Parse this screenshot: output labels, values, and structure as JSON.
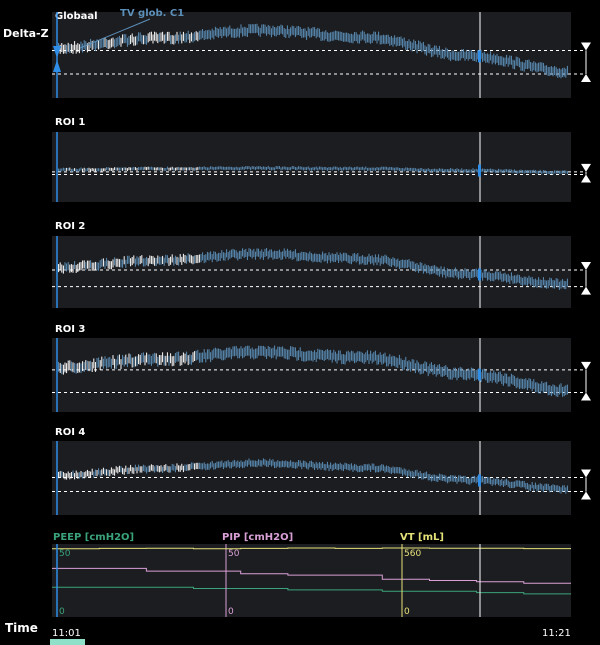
{
  "axis_label_y": "Delta-Z",
  "axis_label_time": "Time",
  "annotation": "TV glob. C1",
  "time_start": "11:01",
  "time_end": "11:21",
  "colors": {
    "plot_bg": "#1c1d20",
    "trace": "#5c8fb8",
    "trace_light": "#ffffff",
    "marker": "#2f8fe8",
    "cursor": "#ffffff",
    "peep": "#3aa37a",
    "pip": "#d9a0d6",
    "vt": "#e6e27a"
  },
  "chart_data": [
    {
      "type": "area",
      "title": "Globaal",
      "shape": [
        0.3,
        0.58,
        0.8,
        0.62,
        0.1,
        -0.35
      ],
      "amplitude": 1.0
    },
    {
      "type": "area",
      "title": "ROI 1",
      "shape": [
        0.02,
        0.06,
        0.08,
        0.06,
        0.0,
        -0.07
      ],
      "amplitude": 0.15
    },
    {
      "type": "area",
      "title": "ROI 2",
      "shape": [
        0.25,
        0.5,
        0.72,
        0.55,
        0.05,
        -0.3
      ],
      "amplitude": 0.9
    },
    {
      "type": "area",
      "title": "ROI 3",
      "shape": [
        0.35,
        0.62,
        0.85,
        0.68,
        0.15,
        -0.38
      ],
      "amplitude": 1.1
    },
    {
      "type": "area",
      "title": "ROI 4",
      "shape": [
        0.2,
        0.42,
        0.6,
        0.45,
        0.05,
        -0.25
      ],
      "amplitude": 0.7
    },
    {
      "type": "line",
      "title": "ventilator",
      "series": [
        {
          "name": "PEEP [cmH2O]",
          "scale_label": "50",
          "zero_label": "0",
          "values": [
            20,
            20,
            20,
            19,
            19,
            18,
            18,
            17,
            17,
            16,
            15
          ]
        },
        {
          "name": "PIP [cmH2O]",
          "scale_label": "50",
          "zero_label": "0",
          "values": [
            34,
            34,
            32,
            32,
            30,
            29,
            29,
            26,
            25,
            24,
            23
          ]
        },
        {
          "name": "VT [mL]",
          "scale_label": "560",
          "zero_label": "0",
          "values": [
            545,
            548,
            550,
            546,
            548,
            552,
            548,
            552,
            549,
            550,
            547
          ]
        }
      ]
    }
  ]
}
